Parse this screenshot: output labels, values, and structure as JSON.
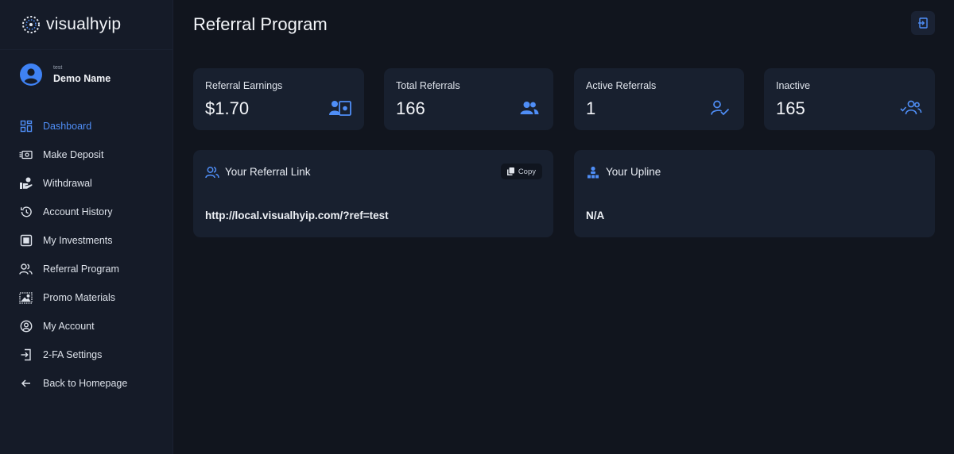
{
  "brand": {
    "name": "visualhyip"
  },
  "profile": {
    "username": "test",
    "display_name": "Demo Name"
  },
  "nav": [
    {
      "label": "Dashboard",
      "icon": "dashboard-grid-icon",
      "active": true
    },
    {
      "label": "Make Deposit",
      "icon": "cash-icon"
    },
    {
      "label": "Withdrawal",
      "icon": "hand-money-icon"
    },
    {
      "label": "Account History",
      "icon": "history-icon"
    },
    {
      "label": "My Investments",
      "icon": "investments-icon"
    },
    {
      "label": "Referral Program",
      "icon": "users-icon"
    },
    {
      "label": "Promo Materials",
      "icon": "image-icon"
    },
    {
      "label": "My Account",
      "icon": "user-circle-icon"
    },
    {
      "label": "2-FA Settings",
      "icon": "login-icon"
    },
    {
      "label": "Back to Homepage",
      "icon": "arrow-left-icon"
    }
  ],
  "header": {
    "title": "Referral Program",
    "action_icon": "logout-icon"
  },
  "stats": [
    {
      "label": "Referral Earnings",
      "value": "$1.70",
      "icon": "earnings-icon"
    },
    {
      "label": "Total Referrals",
      "value": "166",
      "icon": "users-group-icon"
    },
    {
      "label": "Active Referrals",
      "value": "1",
      "icon": "user-check-icon"
    },
    {
      "label": "Inactive",
      "value": "165",
      "icon": "users-inactive-icon"
    }
  ],
  "referral_link": {
    "title": "Your Referral Link",
    "url": "http://local.visualhyip.com/?ref=test",
    "copy_label": "Copy"
  },
  "upline": {
    "title": "Your Upline",
    "value": "N/A"
  },
  "colors": {
    "accent": "#4f8ef7",
    "background": "#11151e",
    "card": "#18202f",
    "sidebar": "#151b28"
  }
}
